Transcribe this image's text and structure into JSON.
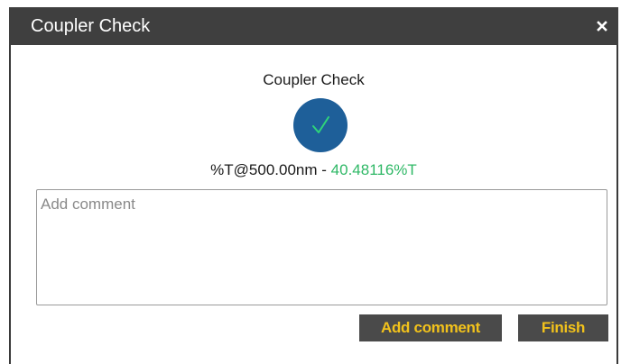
{
  "dialog": {
    "title": "Coupler Check",
    "close_icon": "close-icon",
    "heading": "Coupler Check",
    "status_icon": "checkmark-icon",
    "status_color": "#1e5f99",
    "measurement_label": "%T@500.00nm - ",
    "measurement_value": "40.48116%T",
    "measurement_value_color": "#2fb866"
  },
  "comment": {
    "placeholder": "Add comment",
    "value": ""
  },
  "buttons": {
    "add_comment_label": "Add comment",
    "finish_label": "Finish",
    "text_color": "#f2c21b"
  }
}
